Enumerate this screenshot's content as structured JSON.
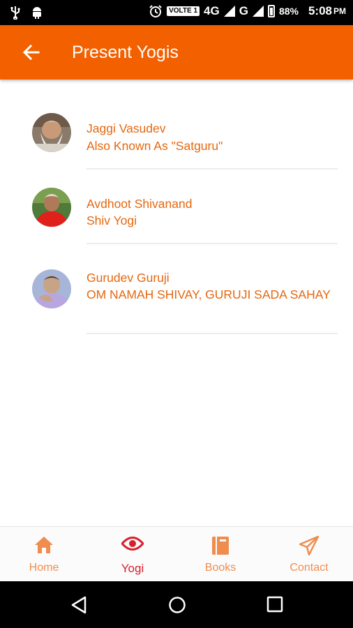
{
  "status_bar": {
    "volte": "VOLTE 1",
    "network_4g": "4G",
    "network_g": "G",
    "battery": "88%",
    "time": "5:08",
    "ampm": "PM"
  },
  "app_bar": {
    "title": "Present Yogis"
  },
  "yogis": [
    {
      "name": "Jaggi Vasudev",
      "subtitle": "Also Known As \"Satguru\""
    },
    {
      "name": "Avdhoot Shivanand",
      "subtitle": "Shiv Yogi"
    },
    {
      "name": "Gurudev Guruji",
      "subtitle": "OM NAMAH SHIVAY, GURUJI SADA SAHAY"
    }
  ],
  "bottom_nav": [
    {
      "label": "Home",
      "icon": "home-icon",
      "active": false
    },
    {
      "label": "Yogi",
      "icon": "eye-icon",
      "active": true
    },
    {
      "label": "Books",
      "icon": "book-icon",
      "active": false
    },
    {
      "label": "Contact",
      "icon": "send-icon",
      "active": false
    }
  ],
  "colors": {
    "accent": "#f26000",
    "text": "#e5670f",
    "active_nav": "#d81f2b",
    "inactive_nav": "#ef8d4e"
  }
}
